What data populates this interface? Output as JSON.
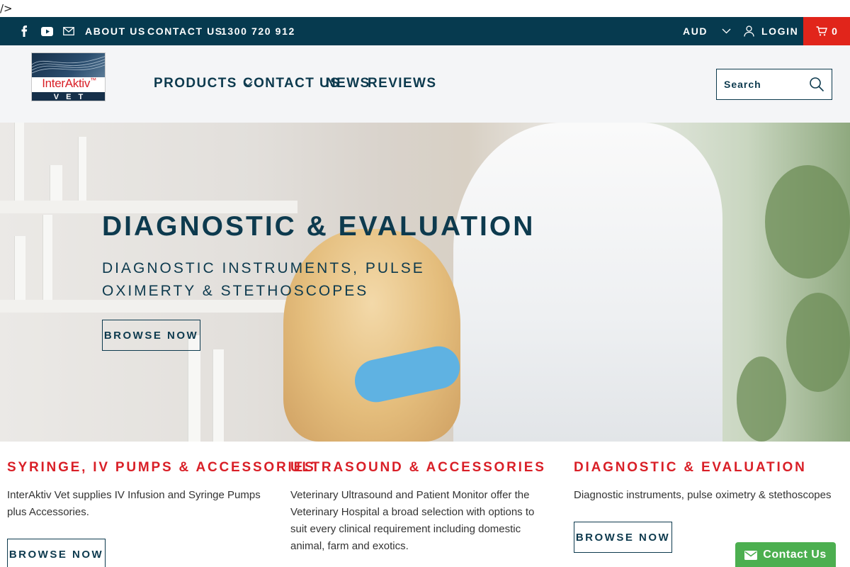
{
  "stray_text": "/>",
  "topbar": {
    "social_icons": [
      "facebook-icon",
      "youtube-icon",
      "email-icon"
    ],
    "links": [
      "ABOUT US",
      "CONTACT US",
      "1300 720 912"
    ],
    "currency": "AUD",
    "login": "LOGIN",
    "cart_count": "0"
  },
  "logo": {
    "brand": "InterAktiv",
    "trademark": "™",
    "sub": "VET"
  },
  "nav": {
    "items": [
      "PRODUCTS",
      "CONTACT US",
      "NEWS",
      "REVIEWS"
    ]
  },
  "search": {
    "placeholder": "Search"
  },
  "hero": {
    "title": "DIAGNOSTIC & EVALUATION",
    "subtitle": "DIAGNOSTIC INSTRUMENTS, PULSE OXIMERTY & STETHOSCOPES",
    "button": "BROWSE NOW"
  },
  "columns": [
    {
      "title": "SYRINGE, IV PUMPS & ACCESSORIES",
      "text": "InterAktiv Vet supplies IV Infusion and Syringe Pumps plus Accessories.",
      "button": "BROWSE NOW"
    },
    {
      "title": "ULTRASOUND & ACCESSORIES",
      "text": "Veterinary Ultrasound and Patient Monitor offer the Veterinary Hospital a broad selection with options to suit every clinical requirement including domestic animal, farm and exotics."
    },
    {
      "title": "DIAGNOSTIC & EVALUATION",
      "text": "Diagnostic instruments, pulse oximetry & stethoscopes",
      "button": "BROWSE NOW"
    }
  ],
  "contact_widget": {
    "label": "Contact Us"
  },
  "colors": {
    "topbar": "#063a4f",
    "brand_navy": "#0d3a4e",
    "accent_red": "#e1251b",
    "heading_red": "#d91f27",
    "widget_green": "#4caf50"
  }
}
